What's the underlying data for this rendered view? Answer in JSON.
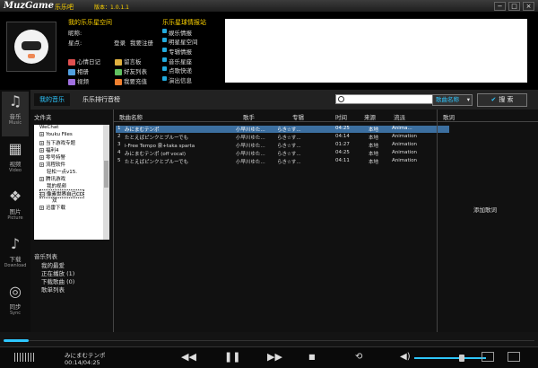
{
  "title": {
    "logo": "MuzGame",
    "logo_cn": "乐乐吧",
    "version": "版本：1.0.1.1",
    "minimize": "−",
    "maximize": "□",
    "close": "×"
  },
  "profile": {
    "space_title": "我的乐乐星空间",
    "nickname_label": "昵称:",
    "stars_label": "星点:",
    "login": "登录",
    "register": "我要注册",
    "links": [
      "心情日记",
      "留言板",
      "相册",
      "好友列表",
      "视频",
      "我要充值"
    ],
    "star_title": "乐乐星球情报站",
    "star_items": [
      "娱乐情报",
      "明星星空间",
      "专辑情报",
      "音乐星座",
      "点歌快递",
      "演出信息"
    ]
  },
  "sidebar": [
    {
      "label": "音乐",
      "en": "Music",
      "icon": "music-note-icon"
    },
    {
      "label": "视频",
      "en": "Video",
      "icon": "film-icon"
    },
    {
      "label": "图片",
      "en": "Picture",
      "icon": "picture-icon"
    },
    {
      "label": "下载",
      "en": "Download",
      "icon": "download-icon"
    },
    {
      "label": "同步",
      "en": "Sync",
      "icon": "sync-icon"
    }
  ],
  "tabs": {
    "my_music": "我的音乐",
    "chart": "乐乐排行音榜"
  },
  "search": {
    "placeholder": "",
    "field": "歌曲名称",
    "button": "搜 索"
  },
  "folders": {
    "header": "文件夹",
    "items": [
      "WeChat",
      "Youku Files",
      "当下游戏专题",
      "福利4",
      "零号特警",
      "流程软件",
      "轻松一点v15.",
      "腾讯游戏",
      "我的视频",
      "像素世界自己CD",
      "双",
      "迅雷下载"
    ]
  },
  "playlists": {
    "header": "音乐列表",
    "items": [
      "我的最爱",
      "正在播放 (1)",
      "下载歌曲 (0)",
      "歌单列表"
    ]
  },
  "columns": {
    "name": "歌曲名称",
    "singer": "歌手",
    "album": "专辑",
    "time": "时间",
    "source": "来源",
    "genre": "流派",
    "lyrics": "歌词"
  },
  "songs": [
    {
      "n": "1",
      "name": "みにまむテンポ",
      "singer": "小早川ゆた...",
      "album": "らき☆す...",
      "time": "04:25",
      "source": "本地",
      "genre": "Anima..."
    },
    {
      "n": "2",
      "name": "たとえばピンクとブルーでも",
      "singer": "小早川ゆた...",
      "album": "らき☆す...",
      "time": "04:14",
      "source": "本地",
      "genre": "Animation"
    },
    {
      "n": "3",
      "name": "i-Free Tempo 泉+taka sparta",
      "singer": "小早川ゆた...",
      "album": "らき☆す...",
      "time": "01:27",
      "source": "本地",
      "genre": "Animation"
    },
    {
      "n": "4",
      "name": "みにまむテンポ (off vocal)",
      "singer": "小早川ゆた...",
      "album": "らき☆す...",
      "time": "04:25",
      "source": "本地",
      "genre": "Animation"
    },
    {
      "n": "5",
      "name": "たとえばピンクとブルーでも",
      "singer": "小早川ゆた...",
      "album": "らき☆す...",
      "time": "04:11",
      "source": "本地",
      "genre": "Animation"
    }
  ],
  "lyrics_add": "添加歌词",
  "player": {
    "title": "みにまむテンポ",
    "time": "00:14/04:25",
    "eq": "ılılılıl"
  }
}
